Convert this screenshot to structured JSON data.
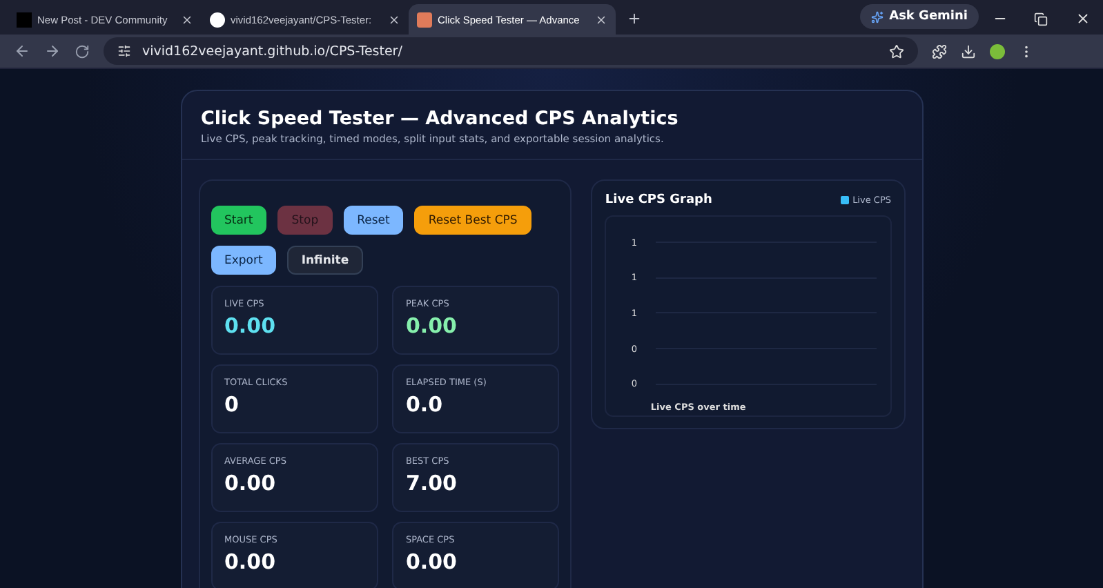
{
  "browser": {
    "tabs": [
      {
        "title": "New Post - DEV Community",
        "kind": "dev",
        "selected": false
      },
      {
        "title": "vivid162veejayant/CPS-Tester:",
        "kind": "github",
        "selected": false
      },
      {
        "title": "Click Speed Tester — Advance",
        "kind": "page",
        "selected": true
      }
    ],
    "ask_button": "Ask Gemini",
    "url": "vivid162veejayant.github.io/CPS-Tester/"
  },
  "header": {
    "title": "Click Speed Tester — Advanced CPS Analytics",
    "subtitle": "Live CPS, peak tracking, timed modes, split input stats, and exportable session analytics."
  },
  "buttons": [
    {
      "label": "Start",
      "kind": "success",
      "disabled": false
    },
    {
      "label": "Stop",
      "kind": "danger",
      "disabled": true
    },
    {
      "label": "Reset",
      "kind": "info",
      "disabled": false
    },
    {
      "label": "Reset Best CPS",
      "kind": "warning",
      "disabled": false
    },
    {
      "label": "Export",
      "kind": "info",
      "disabled": false
    },
    {
      "label": "Infinite",
      "kind": "neutral",
      "disabled": false
    }
  ],
  "stats": [
    {
      "label": "LIVE CPS",
      "value": "0.00",
      "color": "#5ee0f0"
    },
    {
      "label": "PEAK CPS",
      "value": "0.00",
      "color": "#86efac"
    },
    {
      "label": "TOTAL CLICKS",
      "value": "0",
      "color": "#ffffff"
    },
    {
      "label": "ELAPSED TIME (S)",
      "value": "0.0",
      "color": "#ffffff"
    },
    {
      "label": "AVERAGE CPS",
      "value": "0.00",
      "color": "#ffffff"
    },
    {
      "label": "BEST CPS",
      "value": "7.00",
      "color": "#ffffff"
    },
    {
      "label": "MOUSE CPS",
      "value": "0.00",
      "color": "#ffffff"
    },
    {
      "label": "SPACE CPS",
      "value": "0.00",
      "color": "#ffffff"
    }
  ],
  "graph": {
    "title": "Live CPS Graph",
    "legend": {
      "label": "Live CPS",
      "color": "#38bdf8"
    },
    "y_tick_labels": [
      "1",
      "1",
      "1",
      "0",
      "0"
    ],
    "caption": "Live CPS over time"
  }
}
